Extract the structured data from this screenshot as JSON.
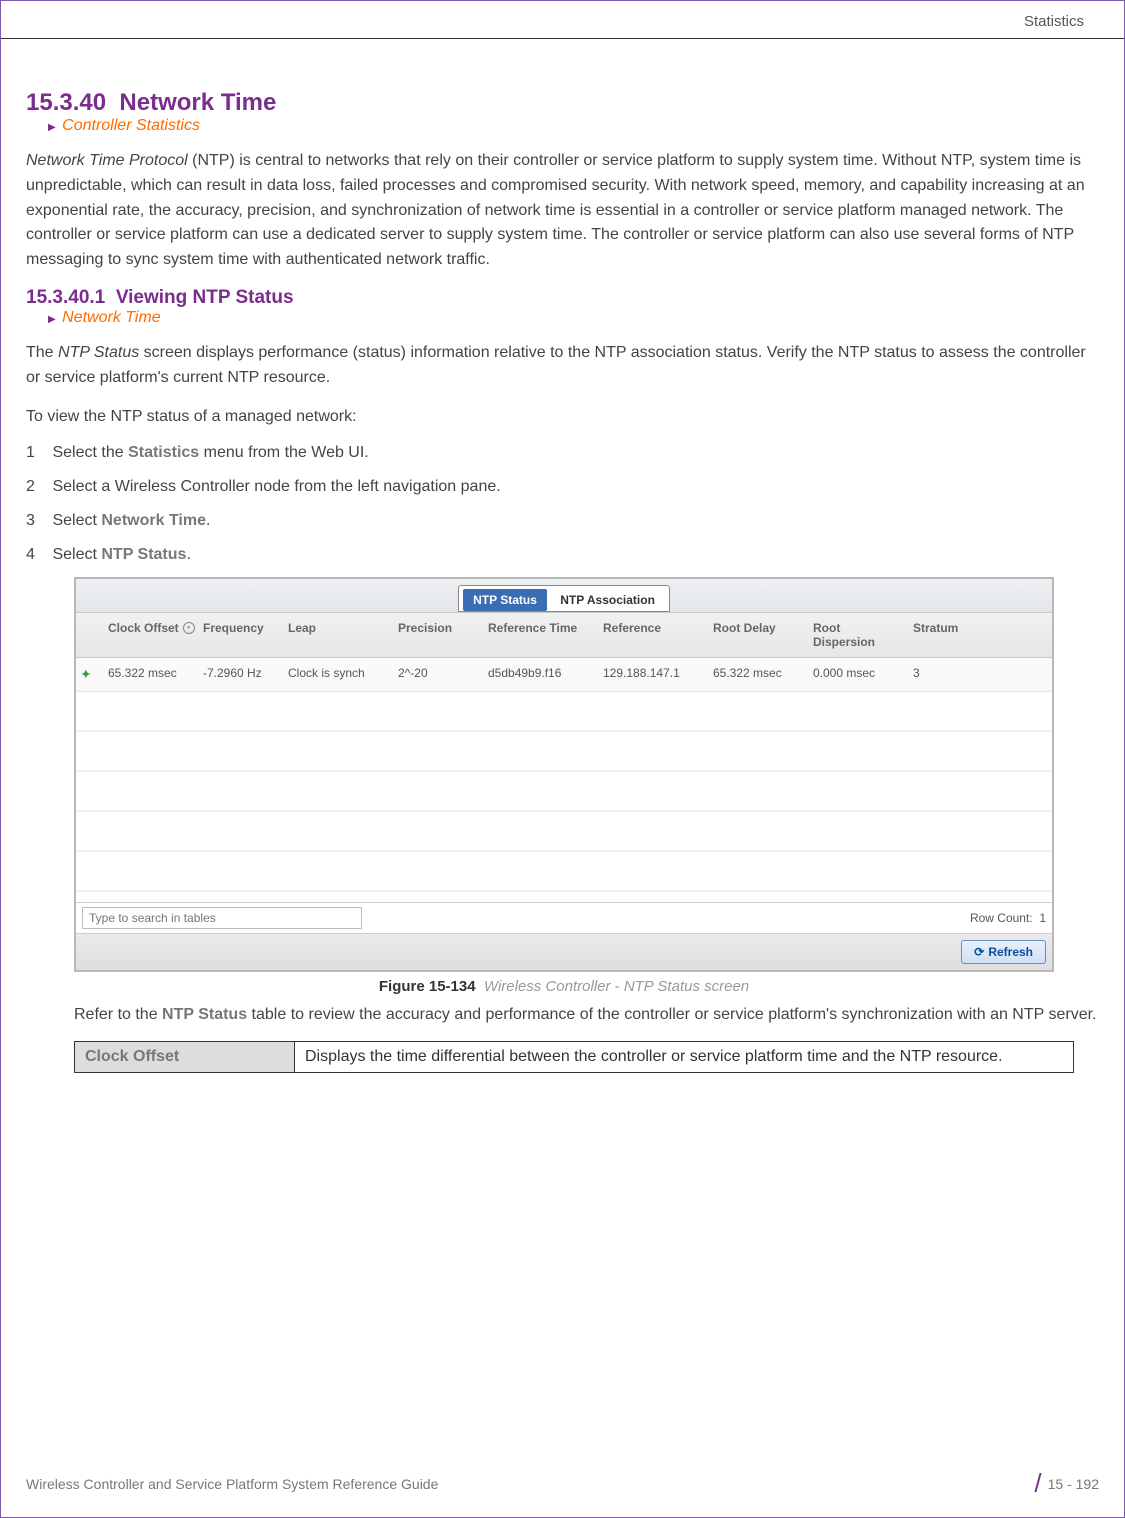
{
  "page_header": "Statistics",
  "section1": {
    "number": "15.3.40",
    "title": "Network Time",
    "crumb": "Controller Statistics",
    "para_prefix_italic": "Network Time Protocol",
    "para_rest": " (NTP) is central to networks that rely on their controller or service platform to supply system time. Without NTP, system time is unpredictable, which can result in data loss, failed processes and compromised security. With network speed, memory, and capability increasing at an exponential rate, the accuracy, precision, and synchronization of network time is essential in a controller or service platform managed network. The controller or service platform can use a dedicated server to supply system time. The controller or service platform can also use several forms of NTP messaging to sync system time with authenticated network traffic."
  },
  "section2": {
    "number": "15.3.40.1",
    "title": "Viewing NTP Status",
    "crumb": "Network Time",
    "para1_pre": "The ",
    "para1_italic": "NTP Status",
    "para1_post": " screen displays performance (status) information relative to the NTP association status. Verify the NTP status to assess the controller or service platform's current NTP resource.",
    "lead": "To view the NTP status of a managed network:",
    "steps": [
      {
        "n": "1",
        "pre": "Select the ",
        "bold": "Statistics",
        "post": " menu from the Web UI."
      },
      {
        "n": "2",
        "pre": "Select a Wireless Controller node from the left navigation pane.",
        "bold": "",
        "post": ""
      },
      {
        "n": "3",
        "pre": "Select ",
        "bold": "Network Time",
        "post": "."
      },
      {
        "n": "4",
        "pre": "Select ",
        "bold": "NTP Status",
        "post": "."
      }
    ]
  },
  "ui": {
    "tabs": {
      "active": "NTP Status",
      "inactive": "NTP Association"
    },
    "headers": [
      "",
      "Clock Offset",
      "Frequency",
      "Leap",
      "Precision",
      "Reference Time",
      "Reference",
      "Root Delay",
      "Root Dispersion",
      "Stratum"
    ],
    "row": [
      "",
      "65.322 msec",
      "-7.2960 Hz",
      "Clock is synch",
      "2^-20",
      "d5db49b9.f16",
      "129.188.147.1",
      "65.322 msec",
      "0.000 msec",
      "3"
    ],
    "search_placeholder": "Type to search in tables",
    "row_count_label": "Row Count:",
    "row_count_value": "1",
    "refresh": "Refresh"
  },
  "figure": {
    "label": "Figure 15-134",
    "caption": "Wireless Controller - NTP Status screen"
  },
  "after_figure_pre": "Refer to the ",
  "after_figure_bold": "NTP Status",
  "after_figure_post": " table to review the accuracy and performance of the controller or service platform's synchronization with an NTP server.",
  "desc_table": {
    "key": "Clock Offset",
    "val": "Displays the time differential between the controller or service platform time and the NTP resource."
  },
  "footer": {
    "left": "Wireless Controller and Service Platform System Reference Guide",
    "right": "15 - 192"
  }
}
